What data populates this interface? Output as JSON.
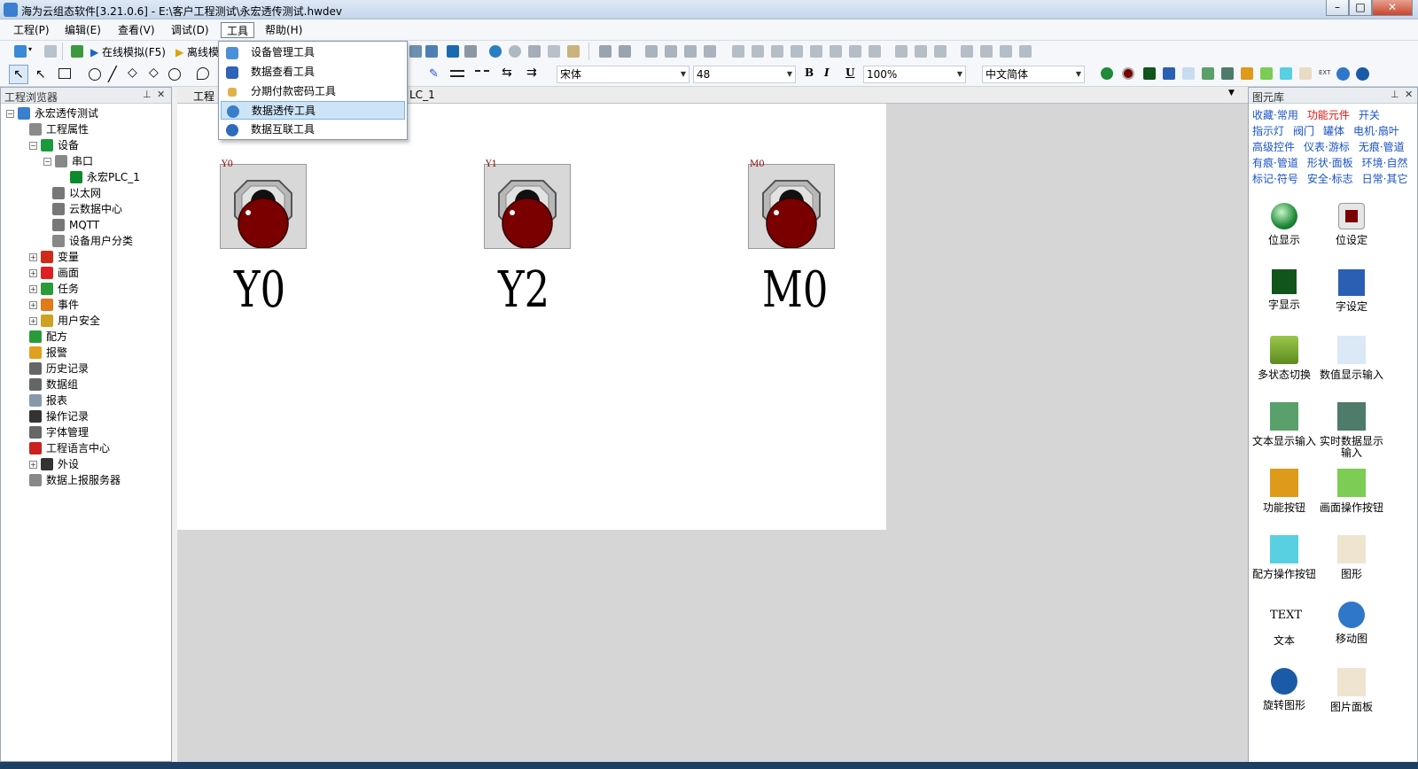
{
  "window": {
    "title": "海为云组态软件[3.21.0.6] - E:\\客户工程测试\\永宏透传测试.hwdev",
    "min": "–",
    "max": "□",
    "close": "✕"
  },
  "menu": {
    "items": [
      "工程(P)",
      "编辑(E)",
      "查看(V)",
      "调试(D)",
      "工具",
      "帮助(H)"
    ]
  },
  "toolbar": {
    "online_sim": "在线模拟(F5)",
    "offline_sim": "离线模",
    "font": "宋体",
    "font_size": "48",
    "zoom": "100%",
    "lang": "中文简体",
    "bold": "B",
    "italic": "I",
    "underline": "U"
  },
  "tools_menu": {
    "items": [
      "设备管理工具",
      "数据查看工具",
      "分期付款密码工具",
      "数据透传工具",
      "数据互联工具"
    ]
  },
  "left_panel": {
    "title": "工程浏览器",
    "pin": "⊥",
    "close": "✕",
    "tree": [
      {
        "label": "永宏透传测试",
        "expander": "−"
      },
      {
        "label": "工程属性"
      },
      {
        "label": "设备",
        "expander": "−"
      },
      {
        "label": "串口",
        "expander": "−"
      },
      {
        "label": "永宏PLC_1"
      },
      {
        "label": "以太网"
      },
      {
        "label": "云数据中心"
      },
      {
        "label": "MQTT"
      },
      {
        "label": "设备用户分类"
      },
      {
        "label": "变量",
        "expander": "+"
      },
      {
        "label": "画面",
        "expander": "+"
      },
      {
        "label": "任务",
        "expander": "+"
      },
      {
        "label": "事件",
        "expander": "+"
      },
      {
        "label": "用户安全",
        "expander": "+"
      },
      {
        "label": "配方"
      },
      {
        "label": "报警"
      },
      {
        "label": "历史记录"
      },
      {
        "label": "数据组"
      },
      {
        "label": "报表"
      },
      {
        "label": "操作记录"
      },
      {
        "label": "字体管理"
      },
      {
        "label": "工程语言中心"
      },
      {
        "label": "外设",
        "expander": "+"
      },
      {
        "label": "数据上报服务器"
      }
    ]
  },
  "tabs": {
    "tab1": "工程",
    "tab2": "LC_1",
    "dropdown_arrow": "▼"
  },
  "canvas": {
    "lamps": [
      {
        "addr": "Y0",
        "label": "Y0"
      },
      {
        "addr": "Y1",
        "label": "Y2"
      },
      {
        "addr": "M0",
        "label": "M0"
      }
    ]
  },
  "right_panel": {
    "title": "图元库",
    "pin": "⊥",
    "close": "✕",
    "categories": [
      [
        "收藏·常用",
        "功能元件",
        "开关"
      ],
      [
        "指示灯",
        "阀门",
        "罐体",
        "电机·扇叶"
      ],
      [
        "高级控件",
        "仪表·游标",
        "无痕·管道"
      ],
      [
        "有痕·管道",
        "形状·面板",
        "环境·自然"
      ],
      [
        "标记·符号",
        "安全·标志",
        "日常·其它"
      ]
    ],
    "items": [
      {
        "label": "位显示"
      },
      {
        "label": "位设定"
      },
      {
        "label": "字显示"
      },
      {
        "label": "字设定"
      },
      {
        "label": "多状态切换"
      },
      {
        "label": "数值显示输入"
      },
      {
        "label": "文本显示输入"
      },
      {
        "label": "实时数据显示输入"
      },
      {
        "label": "功能按钮"
      },
      {
        "label": "画面操作按钮"
      },
      {
        "label": "配方操作按钮"
      },
      {
        "label": "图形"
      },
      {
        "label": "文本",
        "icon_text": "TEXT"
      },
      {
        "label": "移动图"
      },
      {
        "label": "旋转图形"
      },
      {
        "label": "图片面板"
      }
    ]
  },
  "colors": {
    "accent": "#1a53c9",
    "active_category": "#e11111",
    "lamp_red": "#7a0000",
    "hover": "#cde4f7"
  }
}
